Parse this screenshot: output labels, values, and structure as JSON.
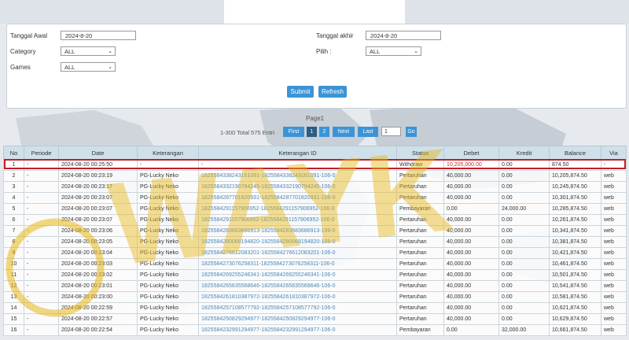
{
  "filters": {
    "tanggal_awal_label": "Tanggal Awal",
    "tanggal_awal_value": "2024-8-20",
    "tanggal_akhir_label": "Tanggal akhir",
    "tanggal_akhir_value": "2024-8-20",
    "category_label": "Category",
    "category_value": "ALL",
    "pilih_label": "Pilih  :",
    "pilih_value": "ALL",
    "games_label": "Games",
    "games_value": "ALL",
    "submit_label": "Submit",
    "refresh_label": "Refresh"
  },
  "pagination": {
    "page_label": "Page1",
    "range_text": "1-300 Total 575 Entri",
    "first_label": "First",
    "page1_label": "1",
    "page2_label": "2",
    "next_label": "Next",
    "last_label": "Last",
    "page_input_value": "1",
    "go_label": "Go"
  },
  "table": {
    "headers": [
      "No",
      "Periode",
      "Date",
      "Keterangan",
      "Keterangan ID",
      "Status",
      "Debet",
      "Kredit",
      "Balance",
      "Via"
    ],
    "rows": [
      [
        "1",
        "-",
        "2024-08-20 00:25:50",
        "-",
        "-",
        "Withdraw",
        "10,205,000.00",
        "0.00",
        "874.50",
        "-"
      ],
      [
        "2",
        "-",
        "2024-08-20 00:23:19",
        "PG-Lucky Neko",
        "1825584338243161091-1825584338243161091-106-0",
        "Pertaruhan",
        "40,000.00",
        "0.00",
        "10,205,874.50",
        "web"
      ],
      [
        "3",
        "-",
        "2024-08-20 00:23:17",
        "PG-Lucky Neko",
        "1825584332190794245-1825584332190794245-106-0",
        "Pertaruhan",
        "40,000.00",
        "0.00",
        "10,245,874.50",
        "web"
      ],
      [
        "4",
        "-",
        "2024-08-20 00:23:07",
        "PG-Lucky Neko",
        "1825584287701820931-1825584287701820931-106-0",
        "Pertaruhan",
        "40,000.00",
        "0.00",
        "10,301,874.50",
        "web"
      ],
      [
        "5",
        "-",
        "2024-08-20 00:23:07",
        "PG-Lucky Neko",
        "1825584291157906952-1825584291157906952-106-0",
        "Pembayaran",
        "0.00",
        "24,000.00",
        "10,285,874.50",
        "web"
      ],
      [
        "6",
        "-",
        "2024-08-20 00:23:07",
        "PG-Lucky Neko",
        "1825584291157906952-1825584291157906952-106-0",
        "Pertaruhan",
        "40,000.00",
        "0.00",
        "10,261,874.50",
        "web"
      ],
      [
        "7",
        "-",
        "2024-08-20 00:23:06",
        "PG-Lucky Neko",
        "1825584283683686913-1825584283683686913-106-0",
        "Pertaruhan",
        "40,000.00",
        "0.00",
        "10,341,874.50",
        "web"
      ],
      [
        "8",
        "-",
        "2024-08-20 00:23:05",
        "PG-Lucky Neko",
        "1825584280068194820-1825584280068194820-106-0",
        "Pertaruhan",
        "40,000.00",
        "0.00",
        "10,381,874.50",
        "web"
      ],
      [
        "9",
        "-",
        "2024-08-20 00:23:04",
        "PG-Lucky Neko",
        "1825584276612083201-1825584276612083201-106-0",
        "Pertaruhan",
        "40,000.00",
        "0.00",
        "10,421,874.50",
        "web"
      ],
      [
        "10",
        "-",
        "2024-08-20 00:23:03",
        "PG-Lucky Neko",
        "1825584273076258311-1825584273076258311-106-0",
        "Pertaruhan",
        "40,000.00",
        "0.00",
        "10,461,874.50",
        "web"
      ],
      [
        "11",
        "-",
        "2024-08-20 00:23:02",
        "PG-Lucky Neko",
        "1825584269255246341-1825584269255246341-106-0",
        "Pertaruhan",
        "40,000.00",
        "0.00",
        "10,501,874.50",
        "web"
      ],
      [
        "12",
        "-",
        "2024-08-20 00:23:01",
        "PG-Lucky Neko",
        "1825584265635568646-1825584265635568646-106-0",
        "Pertaruhan",
        "40,000.00",
        "0.00",
        "10,541,874.50",
        "web"
      ],
      [
        "13",
        "-",
        "2024-08-20 00:23:00",
        "PG-Lucky Neko",
        "1825584261810387972-1825584261810387972-106-0",
        "Pertaruhan",
        "40,000.00",
        "0.00",
        "10,581,874.50",
        "web"
      ],
      [
        "14",
        "-",
        "2024-08-20 00:22:59",
        "PG-Lucky Neko",
        "1825584257108577792-1825584257108577792-106-0",
        "Pertaruhan",
        "40,000.00",
        "0.00",
        "10,621,874.50",
        "web"
      ],
      [
        "15",
        "-",
        "2024-08-20 00:22:57",
        "PG-Lucky Neko",
        "1825584250829294977-1825584250829294977-106-0",
        "Pertaruhan",
        "40,000.00",
        "0.00",
        "10,629,874.50",
        "web"
      ],
      [
        "16",
        "-",
        "2024-08-20 00:22:54",
        "PG-Lucky Neko",
        "1825584232991294977-1825584232991294977-106-0",
        "Pembayaran",
        "0.00",
        "32,000.00",
        "10,661,874.50",
        "web"
      ]
    ]
  },
  "watermark": {
    "text": "WAYK",
    "color": "#e8b818"
  },
  "colors": {
    "accent": "#3c94d6",
    "header_bg": "#cfe0ea",
    "highlight_border": "#c21e28",
    "link": "#4a87b8",
    "debit_red": "#d42a2a"
  }
}
